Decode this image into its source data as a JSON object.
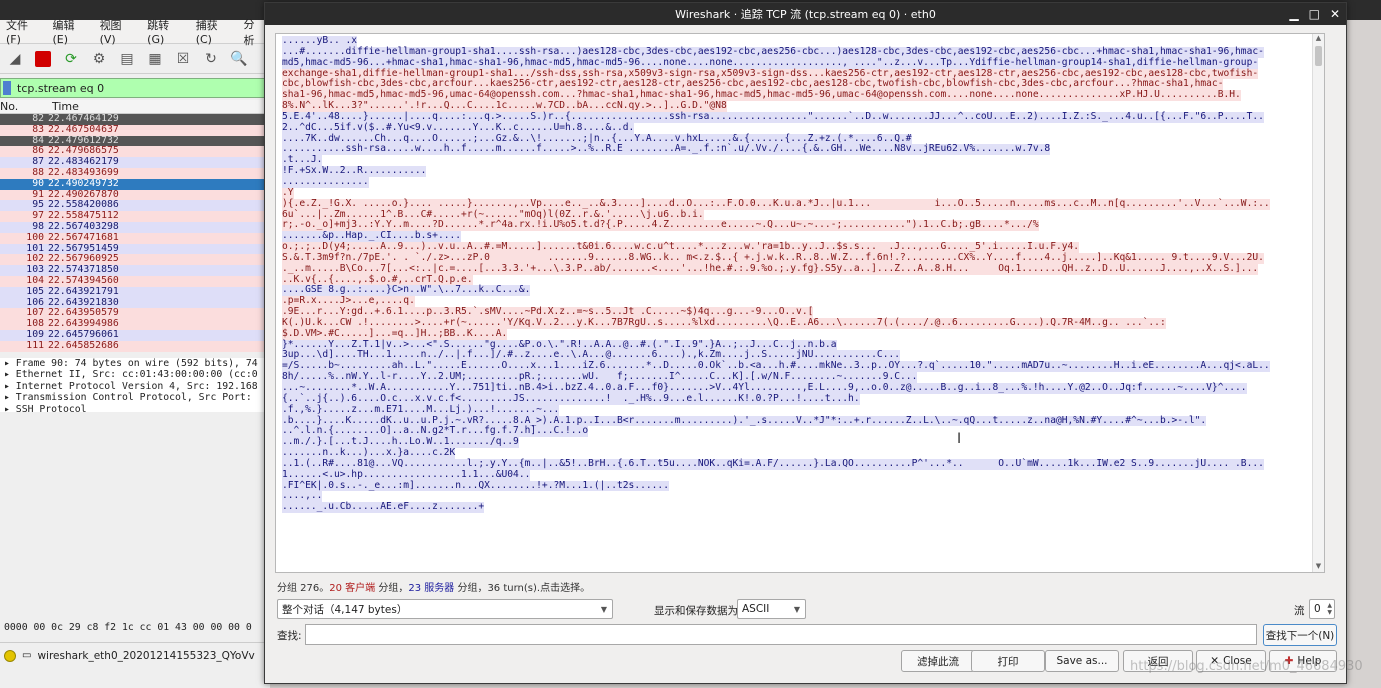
{
  "main_window": {
    "menus": [
      "文件(F)",
      "编辑(E)",
      "视图(V)",
      "跳转(G)",
      "捕获(C)",
      "分析"
    ],
    "toolbar_icons": [
      "shark-fin-icon",
      "stop-icon",
      "restart-icon",
      "options-icon",
      "open-icon",
      "save-icon",
      "close-file-icon",
      "reload-icon",
      "find-icon"
    ],
    "filter_text": "tcp.stream eq 0",
    "col_no": "No.",
    "col_time": "Time",
    "packets": [
      {
        "no": "82",
        "time": "22.467464129",
        "kind": "dim"
      },
      {
        "no": "83",
        "time": "22.467504637",
        "kind": "c"
      },
      {
        "no": "84",
        "time": "22.479612732",
        "kind": "dim"
      },
      {
        "no": "86",
        "time": "22.479686575",
        "kind": "c"
      },
      {
        "no": "87",
        "time": "22.483462179",
        "kind": "s"
      },
      {
        "no": "88",
        "time": "22.483493699",
        "kind": "c"
      },
      {
        "no": "90",
        "time": "22.490249732",
        "kind": "sel"
      },
      {
        "no": "91",
        "time": "22.490267870",
        "kind": "c"
      },
      {
        "no": "95",
        "time": "22.558420086",
        "kind": "s"
      },
      {
        "no": "97",
        "time": "22.558475112",
        "kind": "c"
      },
      {
        "no": "98",
        "time": "22.567403298",
        "kind": "s"
      },
      {
        "no": "100",
        "time": "22.567471681",
        "kind": "c"
      },
      {
        "no": "101",
        "time": "22.567951459",
        "kind": "s"
      },
      {
        "no": "102",
        "time": "22.567960925",
        "kind": "c"
      },
      {
        "no": "103",
        "time": "22.574371850",
        "kind": "s"
      },
      {
        "no": "104",
        "time": "22.574394560",
        "kind": "c"
      },
      {
        "no": "105",
        "time": "22.643921791",
        "kind": "s"
      },
      {
        "no": "106",
        "time": "22.643921830",
        "kind": "s"
      },
      {
        "no": "107",
        "time": "22.643950579",
        "kind": "c"
      },
      {
        "no": "108",
        "time": "22.643994986",
        "kind": "c"
      },
      {
        "no": "109",
        "time": "22.645796061",
        "kind": "s"
      },
      {
        "no": "111",
        "time": "22.645852686",
        "kind": "c"
      }
    ],
    "detail_lines": [
      "▸ Frame 90: 74 bytes on wire (592 bits), 74",
      "▸ Ethernet II, Src: cc:01:43:00:00:00 (cc:0",
      "▸ Internet Protocol Version 4, Src: 192.168",
      "▸ Transmission Control Protocol, Src Port:",
      "▸ SSH Protocol"
    ],
    "hex_line": "0000  00 0c 29 c8 f2 1c cc 01  43 00 00 00 0",
    "status_file": "wireshark_eth0_20201214155323_QYoVv"
  },
  "dialog": {
    "title": "Wireshark · 追踪 TCP 流 (tcp.stream eq 0) · eth0",
    "stream_lines": [
      {
        "k": "s",
        "t": "......yB.. .x"
      },
      {
        "k": "s",
        "t": "...#.......diffie-hellman-group1-sha1....ssh-rsa...)aes128-cbc,3des-cbc,aes192-cbc,aes256-cbc...)aes128-cbc,3des-cbc,aes192-cbc,aes256-cbc...+hmac-sha1,hmac-sha1-96,hmac-"
      },
      {
        "k": "s",
        "t": "md5,hmac-md5-96...+hmac-sha1,hmac-sha1-96,hmac-md5,hmac-md5-96....none....none..................., ....\"..z...v...Tp...Ydiffie-hellman-group14-sha1,diffie-hellman-group-"
      },
      {
        "k": "c",
        "t": "exchange-sha1,diffie-hellman-group1-sha1.../ssh-dss,ssh-rsa,x509v3-sign-rsa,x509v3-sign-dss...kaes256-ctr,aes192-ctr,aes128-ctr,aes256-cbc,aes192-cbc,aes128-cbc,twofish-"
      },
      {
        "k": "c",
        "t": "cbc,blowfish-cbc,3des-cbc,arcfour...kaes256-ctr,aes192-ctr,aes128-ctr,aes256-cbc,aes192-cbc,aes128-cbc,twofish-cbc,blowfish-cbc,3des-cbc,arcfour...?hmac-sha1,hmac-"
      },
      {
        "k": "c",
        "t": "sha1-96,hmac-md5,hmac-md5-96,umac-64@openssh.com...?hmac-sha1,hmac-sha1-96,hmac-md5,hmac-md5-96,umac-64@openssh.com....none....none..............xP.HJ.U..........B.H."
      },
      {
        "k": "c",
        "t": "8%.N^..lK...3?\"......'.!r...Q...C....1c.....w.7CD..bA...ccN.qy.>..]..G.D.\"@N8"
      },
      {
        "k": "s",
        "t": "5.E.4'..48....}......|....q....:...q.>.....S.)r..{.................ssh-rsa.................\"......`..D..w.......JJ...^..coU...E..2)....I.Z.:S._...4.u..[{...F.\"6..P....T.."
      },
      {
        "k": "s",
        "t": "2..^dC...5if.v($..#.Yu<9.v.......Y...K..c......U=h.8....&..d."
      },
      {
        "k": "s",
        "t": "....7K..dw......Ch...q....O......;...Gz.&..\\!.......;|n..{...Y.A....v.hxL.....&.{......{...Z.+z.(.*....6..Q.#"
      },
      {
        "k": "s",
        "t": "...........ssh-rsa.....w....h..f.....m......f.....>..%..R.E ........A=._.f.:n`.u/.Vv./....{.&..GH...We....N8v..jREu62.V%.......w.7v.8"
      },
      {
        "k": "s",
        "t": ".t...J."
      },
      {
        "k": "s",
        "t": "!F.+Sx.W..2..R..........."
      },
      {
        "k": "s",
        "t": "..............."
      },
      {
        "k": "c",
        "t": ".Y"
      },
      {
        "k": "c",
        "t": "){.e.Z._!G.X. .....o.}.... .....}.......,..Vp....e.._..&.3....]....d..O...:..F.O.0...K.u.a.*J..|u.1...           i...O..5.....n.....ms...c..M..n[q.........'..V...`...W.:.."
      },
      {
        "k": "c",
        "t": "6u`...|..Zm......1^.B...C#.....+r(~......\"mOq)l(0Z..r.&.'.....\\j.u6..b.i."
      },
      {
        "k": "c",
        "t": "r;.-o._o]+mj3..:Y.Y..m....?D......*.r^4a.rx.!i.U%o5.t.d?{.P.....4.Z.........e.....~.Q...u~.~...-;...........\").1..C.b;.gB....*.../%"
      },
      {
        "k": "s",
        "t": ".......&p..Hap._.CI....b.s+...."
      },
      {
        "k": "c",
        "t": "o.;.;..D(y4;.....A..9...)..v.u..A..#.=M.....]......t&0i.6....w.c.u^t....*...z...w.'ra=1b..y..J..$s.s...  .J...,...G...._5'.i.....I.u.F.y4."
      },
      {
        "k": "c",
        "t": "S.&.T.3m9f?n./7pE.'. . `./.z>...zP.0          .......9......8.WG..k.. m<.z.$..{ +.j.w.k..R..8..W.Z...f.6n!.?.........CX%..Y....f....4..j.....]..Kq&1..... 9.t....9.V...2U."
      },
      {
        "k": "c",
        "t": "._..m.....B\\Co...7[...<:..|c.=....[...3.3.'+...\\.3.P..ab/.......<....'...!he.#.:.9.%o.;.y.fg}.S5y..a..]...Z...A..8.H...     Oq.1.......QH..z..D..U......J....,..X..S.]..."
      },
      {
        "k": "c",
        "t": "..K.v{..{....,.$.o.#,..crT.Q.p.e."
      },
      {
        "k": "s",
        "t": "....GSE 8.g..:....}C>n..W\".\\..7...k..C...&."
      },
      {
        "k": "c",
        "t": ".p=R.x....J>...e,....q."
      },
      {
        "k": "c",
        "t": ".9E...r...Y:gd..+.6.1....p..3.R5.`.sMV....~Pd.X.z..=~s..5..Jt .C.....~$)4q...g...-9...O..v.["
      },
      {
        "k": "c",
        "t": "K(.)U.k...CW .!........>....+r(~......'Y/Kq.V..2...y.K...7B7RgU..s.....%lxd.........\\Q..E..A6...\\......7(.(..../.@..6.........G....).Q.7R-4M..g.. ...`..:"
      },
      {
        "k": "c",
        "t": "$.D.VM>.#C.....]...=q..]H..;BB..K....A."
      },
      {
        "k": "s",
        "t": "}*......Y...Z.T.1|v..>...<\".S......\"g....&P.o.\\.\".R!..A.A..@..#.(.\".I..9\".}A..;..J...C..j..n.b.a"
      },
      {
        "k": "s",
        "t": "3up...\\d]....TH...1.....n../..|.f...]/.#..z....e..\\.A...@.......6....).,k.Zm....j..S.....jNU...........C..."
      },
      {
        "k": "s",
        "t": "=/S.....b~.........ah..L.\".....E......O....x...1....iZ.6.......*..D.....0.Ok`..b.<a...h.#....mkNe..3..p..OY...?.q`.....10.\".....mAD7u..~........H..i.eE........A...qj<.aL.."
      },
      {
        "k": "s",
        "t": "8h/.....%..nW.Y..l-r....Y..2.UM;.........pR.;.......wU.   f;.......I^.....C...K].[.w/N.F........~.......9.C..."
      },
      {
        "k": "s",
        "t": "...~........*..W.A...........Y...751]ti..nB.4>i..bzZ.4..0.a.F...f0}.......>V..4Yl.........,E.L....9,..o.0..z@.....B..g..i..8_...%.!h....Y.@2..O..Jq:f......~....V}^...."
      },
      {
        "k": "s",
        "t": "{..`..j{..).6....O.c...x.v.c.f<.........JS..............!  ._.H%..9...e.l......K!.0.?P...!....t...h."
      },
      {
        "k": "s",
        "t": ".f.,%.}.....z...m.E71....M...Lj.)...!.......~..."
      },
      {
        "k": "s",
        "t": ".b....}....K.....dK..u..u.P.j.~.vR?.....8.A_>).A.1.p..I...B<r.......m.........).'_.s.....V..*J\"*:..+.r......Z..L.\\..~.qQ...t.....z..na@H,%N.#Y....#^~...b.>-.l\"."
      },
      {
        "k": "s",
        "t": "..^.l.n.{........O]..a..N.g2*T.r...fg.f.7.h]...C.!..o"
      },
      {
        "k": "s",
        "t": "..m./.}.[...t.J....h..Lo.W..1......./q..9"
      },
      {
        "k": "s",
        "t": ".......n..k...)...x.}a....c.2K"
      },
      {
        "k": "s",
        "t": "..1.(..R#....81@...VQ...........l.;.y.Y..{m..|..&5!..BrH..{.6.T..t5u....NOK..qKi=.A.F/......}.La.QO..........P^'...*..      O..U`mW.....1k...IW.e2 S..9.......jU.... .B..."
      },
      {
        "k": "s",
        "t": "1......<.u>.hp.................1.1...&U04.."
      },
      {
        "k": "s",
        "t": ".FI^EK|.0.s..-._e...:m].......n...QX........!+.?M...1.(|..t2s......"
      },
      {
        "k": "s",
        "t": "....,.."
      },
      {
        "k": "s",
        "t": "......_.u.Cb.....AE.eF....z.......+"
      }
    ],
    "info_prefix": "分组 276。",
    "info_client": "20 客户端",
    "info_mid": " 分组，",
    "info_server": "23 服务器",
    "info_suffix": " 分组，36 turn(s).点击选择。",
    "conversation_select": "整个对话（4,147 bytes）",
    "display_label": "显示和保存数据为",
    "display_select": "ASCII",
    "stream_label": "流",
    "stream_value": "0",
    "find_label": "查找:",
    "find_value": "",
    "find_next_label": "查找下一个(N)",
    "buttons": {
      "filter_out": "滤掉此流",
      "print": "打印",
      "save_as": "Save as...",
      "back": "返回",
      "close": "Close",
      "help": "Help"
    },
    "watermark": "https://blog.csdn.net/m0_46684930"
  }
}
